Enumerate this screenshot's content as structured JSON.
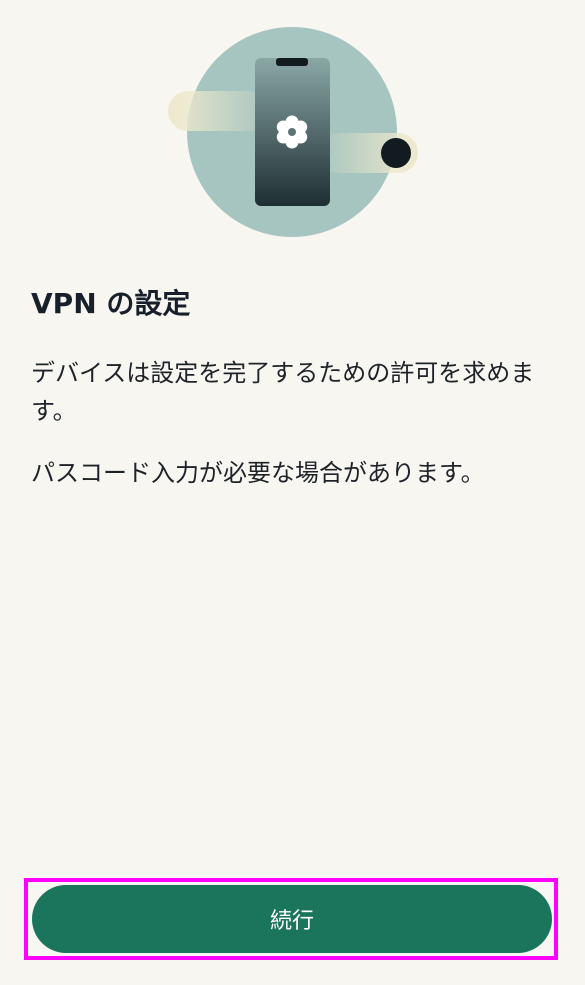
{
  "illustration": {
    "icon": "settings-gear-icon",
    "colors": {
      "circle": "#a7c5c0",
      "band": "#ede8cc",
      "phone_top": "#8aa7a6",
      "phone_bottom": "#1e2e33",
      "dot": "#111b20"
    }
  },
  "content": {
    "title": "VPN の設定",
    "paragraph_1": "デバイスは設定を完了するための許可を求めます。",
    "paragraph_2": "パスコード入力が必要な場合があります。"
  },
  "footer": {
    "continue_label": "続行",
    "button_color": "#1a755c",
    "highlight_color": "#ff00ff"
  }
}
